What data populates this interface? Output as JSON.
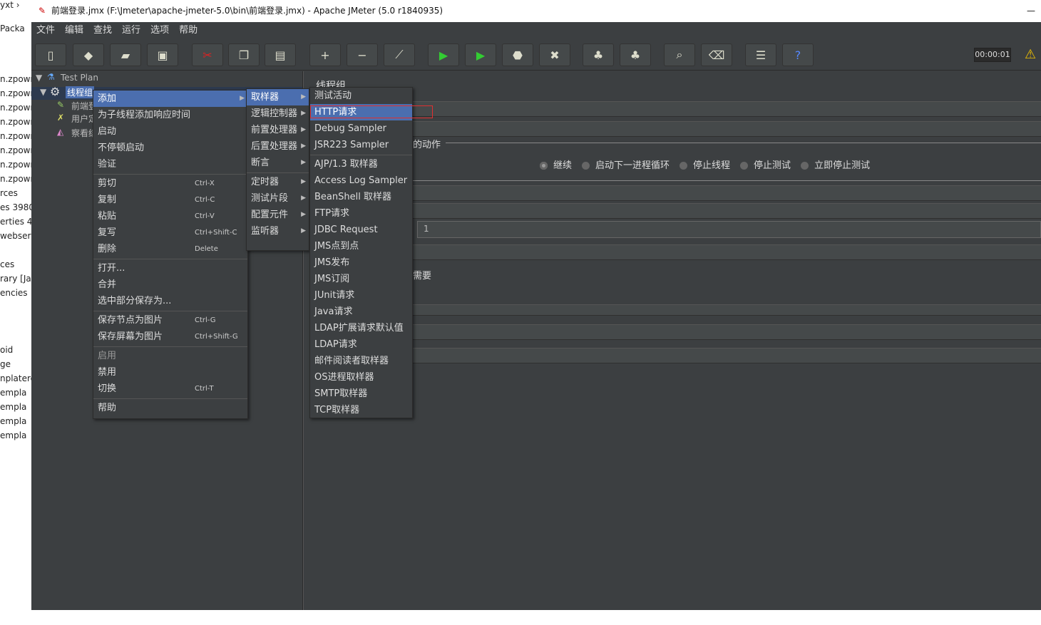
{
  "left_strip": {
    "items": [
      "yxt ›",
      "Packa",
      "n.zpown",
      "n.zpown",
      "n.zpown",
      "n.zpown",
      "n.zpown",
      "n.zpown",
      "n.zpown",
      "n.zpown",
      "rces",
      "es 3980",
      "erties 4",
      "webserv",
      "ces",
      "rary [Jav",
      "encies",
      "oid",
      "ge",
      "nplatere",
      "empla",
      "empla",
      "empla",
      "empla"
    ]
  },
  "window": {
    "title": "前端登录.jmx (F:\\Jmeter\\apache-jmeter-5.0\\bin\\前端登录.jmx) - Apache JMeter (5.0 r1840935)",
    "minimize": "—"
  },
  "menubar": [
    "文件",
    "编辑",
    "查找",
    "运行",
    "选项",
    "帮助"
  ],
  "toolbar": {
    "icons": [
      "new-icon",
      "templates-icon",
      "open-icon",
      "save-icon",
      "cut-icon",
      "copy-icon",
      "paste-icon",
      "expand-icon",
      "collapse-icon",
      "toggle-icon",
      "start-icon",
      "start-no-pause-icon",
      "stop-icon",
      "shutdown-icon",
      "clear-icon",
      "clear-all-icon",
      "search-icon",
      "reset-search-icon",
      "function-helper-icon",
      "help-icon"
    ],
    "glyphs": [
      "▯",
      "◆",
      "▰",
      "▣",
      "✂",
      "❐",
      "▤",
      "+",
      "−",
      "⟋",
      "▶",
      "▶",
      "⬣",
      "✖",
      "♣",
      "♣",
      "⌕",
      "⌫",
      "☰",
      "?"
    ],
    "timer": "00:00:01",
    "warning": "⚠"
  },
  "tree": {
    "nodes": [
      "Test Plan",
      "线程组",
      "前端登",
      "用户定",
      "察看结"
    ]
  },
  "right": {
    "title": "线程组",
    "action_label": "的动作",
    "radios": [
      "继续",
      "启动下一进程循环",
      "停止线程",
      "停止测试",
      "立即停止测试"
    ],
    "selected_radio": "继续",
    "loop_value": "1",
    "need_label": "需要"
  },
  "context_menu": {
    "items": [
      {
        "label": "添加",
        "arrow": true,
        "hl": true
      },
      {
        "label": "为子线程添加响应时间"
      },
      {
        "label": "启动"
      },
      {
        "label": "不停顿启动"
      },
      {
        "label": "验证",
        "sep": true
      },
      {
        "label": "剪切",
        "sc": "Ctrl-X"
      },
      {
        "label": "复制",
        "sc": "Ctrl-C"
      },
      {
        "label": "粘贴",
        "sc": "Ctrl-V"
      },
      {
        "label": "复写",
        "sc": "Ctrl+Shift-C"
      },
      {
        "label": "删除",
        "sc": "Delete",
        "sep": true
      },
      {
        "label": "打开..."
      },
      {
        "label": "合并"
      },
      {
        "label": "选中部分保存为...",
        "sep": true
      },
      {
        "label": "保存节点为图片",
        "sc": "Ctrl-G"
      },
      {
        "label": "保存屏幕为图片",
        "sc": "Ctrl+Shift-G",
        "sep": true
      },
      {
        "label": "启用",
        "dis": true
      },
      {
        "label": "禁用"
      },
      {
        "label": "切换",
        "sc": "Ctrl-T",
        "sep": true
      },
      {
        "label": "帮助"
      }
    ]
  },
  "add_submenu": {
    "items": [
      {
        "label": "取样器",
        "arrow": true,
        "hl": true
      },
      {
        "label": "逻辑控制器",
        "arrow": true
      },
      {
        "label": "前置处理器",
        "arrow": true
      },
      {
        "label": "后置处理器",
        "arrow": true
      },
      {
        "label": "断言",
        "arrow": true,
        "sep": true
      },
      {
        "label": "定时器",
        "arrow": true
      },
      {
        "label": "测试片段",
        "arrow": true
      },
      {
        "label": "配置元件",
        "arrow": true
      },
      {
        "label": "监听器",
        "arrow": true
      }
    ]
  },
  "sampler_submenu": {
    "items": [
      {
        "label": "测试活动"
      },
      {
        "label": "HTTP请求",
        "hl": true
      },
      {
        "label": "Debug Sampler"
      },
      {
        "label": "JSR223 Sampler",
        "sep": true
      },
      {
        "label": "AJP/1.3 取样器"
      },
      {
        "label": "Access Log Sampler"
      },
      {
        "label": "BeanShell 取样器"
      },
      {
        "label": "FTP请求"
      },
      {
        "label": "JDBC Request"
      },
      {
        "label": "JMS点到点"
      },
      {
        "label": "JMS发布"
      },
      {
        "label": "JMS订阅"
      },
      {
        "label": "JUnit请求"
      },
      {
        "label": "Java请求"
      },
      {
        "label": "LDAP扩展请求默认值"
      },
      {
        "label": "LDAP请求"
      },
      {
        "label": "邮件阅读者取样器"
      },
      {
        "label": "OS进程取样器"
      },
      {
        "label": "SMTP取样器"
      },
      {
        "label": "TCP取样器"
      }
    ]
  },
  "colors": {
    "background": "#3c3f41",
    "highlight": "#4b6eaf",
    "annotation": "#e03030"
  }
}
